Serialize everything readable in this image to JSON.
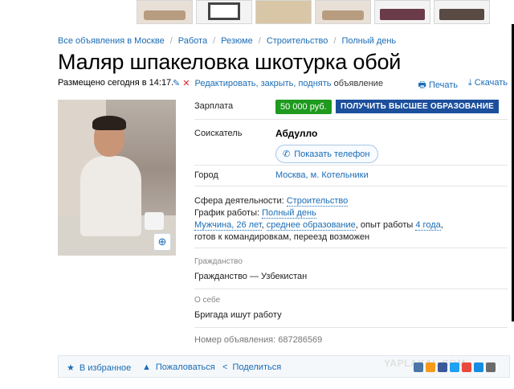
{
  "breadcrumbs": [
    "Все объявления в Москве",
    "Работа",
    "Резюме",
    "Строительство",
    "Полный день"
  ],
  "title": "Маляр шпакеловка шкотурка обой",
  "meta": {
    "posted": "Размещено сегодня в 14:17.",
    "edit_link": "Редактировать, закрыть, поднять",
    "edit_suffix": "объявление",
    "print": "Печать",
    "download": "Скачать"
  },
  "salary": {
    "label": "Зарплата",
    "value": "50 000 руб.",
    "edu_button": "ПОЛУЧИТЬ ВЫСШЕЕ ОБРАЗОВАНИЕ"
  },
  "applicant": {
    "label": "Соискатель",
    "name": "Абдулло",
    "phone_button": "Показать телефон"
  },
  "city": {
    "label": "Город",
    "value": "Москва, м. Котельники"
  },
  "details": {
    "sphere_label": "Сфера деятельности:",
    "sphere": "Строительство",
    "schedule_label": "График работы:",
    "schedule": "Полный день",
    "gender_age": "Мужчина, 26 лет",
    "education": "среднее образование",
    "experience_label": ", опыт работы",
    "experience": "4 года",
    "extra": ", готов к командировкам, переезд возможен"
  },
  "citizenship": {
    "label": "Гражданство",
    "value": "Гражданство — Узбекистан"
  },
  "about": {
    "label": "О себе",
    "value": "Бригада ишут работу"
  },
  "ad_number": "Номер объявления: 687286569",
  "bottom": {
    "favorite": "В избранное",
    "report": "Пожаловаться",
    "share": "Поделиться"
  },
  "watermark": "YAPLAKAL.COM",
  "colors": {
    "link": "#1a6cb5",
    "salary_green": "#1e9a1e",
    "edu_blue": "#1c4f9c"
  }
}
